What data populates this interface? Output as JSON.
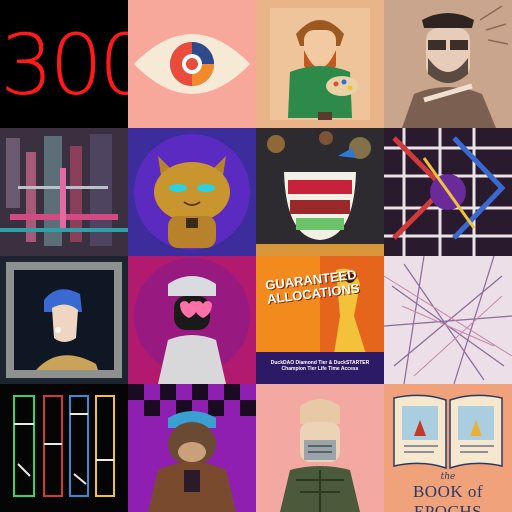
{
  "gallery": {
    "tiles": [
      {
        "id": "t1",
        "text": "300",
        "colors": {
          "bg": "#000000",
          "fg": "#ff1a1a"
        }
      },
      {
        "id": "t2",
        "icon": "eye-icon",
        "colors": {
          "bg": "#f7a89a"
        }
      },
      {
        "id": "t3",
        "colors": {
          "bg": "#e8b48a"
        }
      },
      {
        "id": "t4",
        "colors": {
          "bg": "#c7a189"
        }
      },
      {
        "id": "t5",
        "colors": {
          "bg": "#3a3040"
        }
      },
      {
        "id": "t6",
        "colors": {
          "bg": "#3b2b9a"
        }
      },
      {
        "id": "t7",
        "colors": {
          "bg": "#2b2a2f"
        }
      },
      {
        "id": "t8",
        "colors": {
          "bg": "#2a1a2e"
        }
      },
      {
        "id": "t9",
        "colors": {
          "bg": "#1c2430"
        }
      },
      {
        "id": "t10",
        "colors": {
          "bg": "#c21a6a"
        }
      },
      {
        "id": "t11",
        "title": "GUARANTEED ALLOCATIONS",
        "subtitle": "DuckDAO Diamond Tier & DuckSTARTER Champion Tier Life Time Access",
        "colors": {
          "bg": "#f28a1e"
        }
      },
      {
        "id": "t12",
        "colors": {
          "bg": "#e7d8e2"
        }
      },
      {
        "id": "t13",
        "colors": {
          "bg": "#050505"
        }
      },
      {
        "id": "t14",
        "colors": {
          "bg": "#8f1fb1"
        }
      },
      {
        "id": "t15",
        "colors": {
          "bg": "#f3a9a1"
        }
      },
      {
        "id": "t16",
        "the": "the",
        "title": "BOOK of EPOCHS",
        "colors": {
          "bg": "#f0a37a"
        }
      }
    ]
  }
}
